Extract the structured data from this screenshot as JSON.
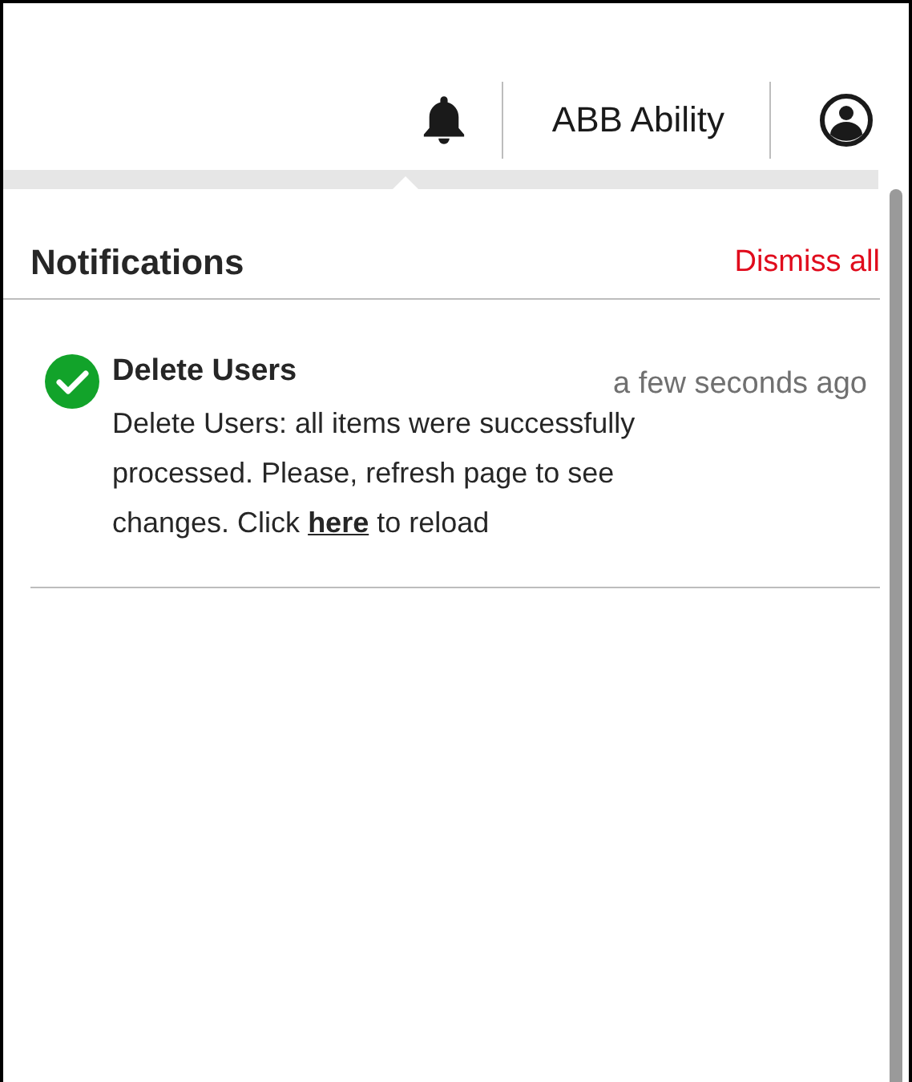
{
  "header": {
    "product": "ABB Ability"
  },
  "panel": {
    "title": "Notifications",
    "dismiss_all": "Dismiss all"
  },
  "notifications": [
    {
      "kind": "success",
      "title": "Delete Users",
      "time": "a few seconds ago",
      "message_before": "Delete Users: all items were successfully processed. Please, refresh page to see changes. Click ",
      "link": "here",
      "message_after": " to reload"
    }
  ]
}
